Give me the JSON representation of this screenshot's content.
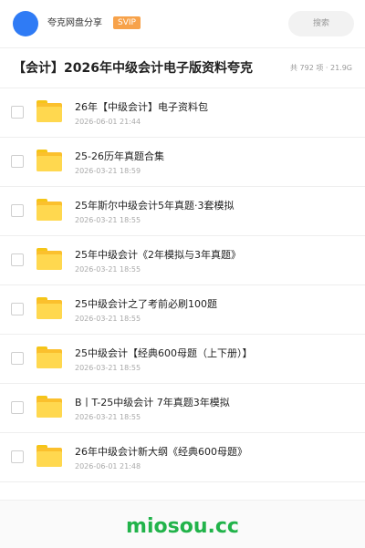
{
  "header": {
    "app_name": "夸克网盘分享",
    "badge": "SVIP",
    "search_label": "搜索",
    "avatar_color": "#2f7bf5",
    "badge_color": "#f7a24a"
  },
  "share": {
    "title": "【会计】2026年中级会计电子版资料夸克",
    "summary": "共 792 项 · 21.9G"
  },
  "files": [
    {
      "name": "26年【中级会计】电子资料包",
      "date": "2026-06-01 21:44",
      "icon": "folder-icon"
    },
    {
      "name": "25-26历年真题合集",
      "date": "2026-03-21 18:59",
      "icon": "folder-icon"
    },
    {
      "name": "25年斯尔中级会计5年真题·3套模拟",
      "date": "2026-03-21 18:55",
      "icon": "folder-icon"
    },
    {
      "name": "25年中级会计《2年模拟与3年真题》",
      "date": "2026-03-21 18:55",
      "icon": "folder-icon"
    },
    {
      "name": "25中级会计之了考前必刷100题",
      "date": "2026-03-21 18:55",
      "icon": "folder-icon"
    },
    {
      "name": "25中级会计【经典600母题（上下册）】",
      "date": "2026-03-21 18:55",
      "icon": "folder-icon"
    },
    {
      "name": "B丨T-25中级会计  7年真题3年模拟",
      "date": "2026-03-21 18:55",
      "icon": "folder-icon"
    },
    {
      "name": "26年中级会计新大纲《经典600母题》",
      "date": "2026-06-01 21:48",
      "icon": "folder-icon"
    }
  ],
  "footer": {
    "brand": "miosou.cc",
    "brand_color": "#21b34a"
  }
}
